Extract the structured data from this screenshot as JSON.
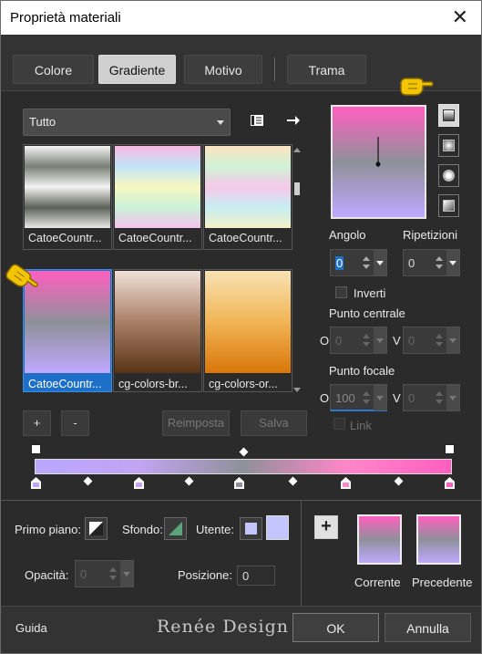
{
  "window": {
    "title": "Proprietà materiali",
    "close_glyph": "✕"
  },
  "tabs": [
    {
      "label": "Colore",
      "active": false
    },
    {
      "label": "Gradiente",
      "active": true
    },
    {
      "label": "Motivo",
      "active": false
    },
    {
      "label": "Trama",
      "active": false
    }
  ],
  "category_select": {
    "value": "Tutto"
  },
  "gradients": [
    {
      "label": "CatoeCountr...",
      "colors": [
        "#f4f4f4",
        "#7b7f77",
        "#f2f2f2",
        "#5c6058",
        "#e8e8e8"
      ],
      "selected": false
    },
    {
      "label": "CatoeCountr...",
      "colors": [
        "#f8b9e3",
        "#bfe4f7",
        "#f7f7c0",
        "#c9f1d8",
        "#f5c2ea"
      ],
      "selected": false
    },
    {
      "label": "CatoeCountr...",
      "colors": [
        "#fbe3c1",
        "#d0f2d5",
        "#f6c8ea",
        "#c5eef1",
        "#f6f0c9"
      ],
      "selected": false
    },
    {
      "label": "CatoeCountr...",
      "colors": [
        "#ff5fc0",
        "#8f9099",
        "#bfa8ff"
      ],
      "selected": true
    },
    {
      "label": "cg-colors-br...",
      "colors": [
        "#f1e0d8",
        "#a97f66",
        "#5a3416"
      ],
      "selected": false
    },
    {
      "label": "cg-colors-or...",
      "colors": [
        "#f8e2b4",
        "#f1b455",
        "#d9760a"
      ],
      "selected": false
    }
  ],
  "preview": {
    "colors": [
      "#ff5fc0",
      "#8f9099",
      "#bfa8ff"
    ]
  },
  "gradient_types": [
    {
      "name": "linear-gradient-icon",
      "active": true
    },
    {
      "name": "rectangular-gradient-icon",
      "active": false
    },
    {
      "name": "radial-gradient-icon",
      "active": false
    },
    {
      "name": "sunburst-gradient-icon",
      "active": false
    }
  ],
  "angle": {
    "label": "Angolo",
    "value": "0"
  },
  "repeats": {
    "label": "Ripetizioni",
    "value": "0"
  },
  "invert": {
    "label": "Inverti",
    "checked": false
  },
  "center_point": {
    "label": "Punto centrale",
    "o_label": "O",
    "o_value": "0",
    "v_label": "V",
    "v_value": "0"
  },
  "focal_point": {
    "label": "Punto focale",
    "o_label": "O",
    "o_value": "100",
    "v_label": "V",
    "v_value": "0"
  },
  "link": {
    "label": "Link",
    "checked": false
  },
  "buttons": {
    "add": "+",
    "remove": "-",
    "reset": "Reimposta",
    "save": "Salva"
  },
  "gradient_bar": {
    "colors": [
      "#b9a6ff",
      "#c2a4f2",
      "#8f9099",
      "#ff86c8",
      "#ff5fc0"
    ]
  },
  "bottom": {
    "foreground_label": "Primo piano:",
    "background_label": "Sfondo:",
    "user_label": "Utente:",
    "opacity_label": "Opacità:",
    "opacity_value": "0",
    "position_label": "Posizione:",
    "position_value": "0",
    "current_label": "Corrente",
    "previous_label": "Precedente",
    "add_glyph": "+"
  },
  "footer": {
    "help": "Guida",
    "ok": "OK",
    "cancel": "Annulla",
    "watermark": "Renée Design"
  }
}
